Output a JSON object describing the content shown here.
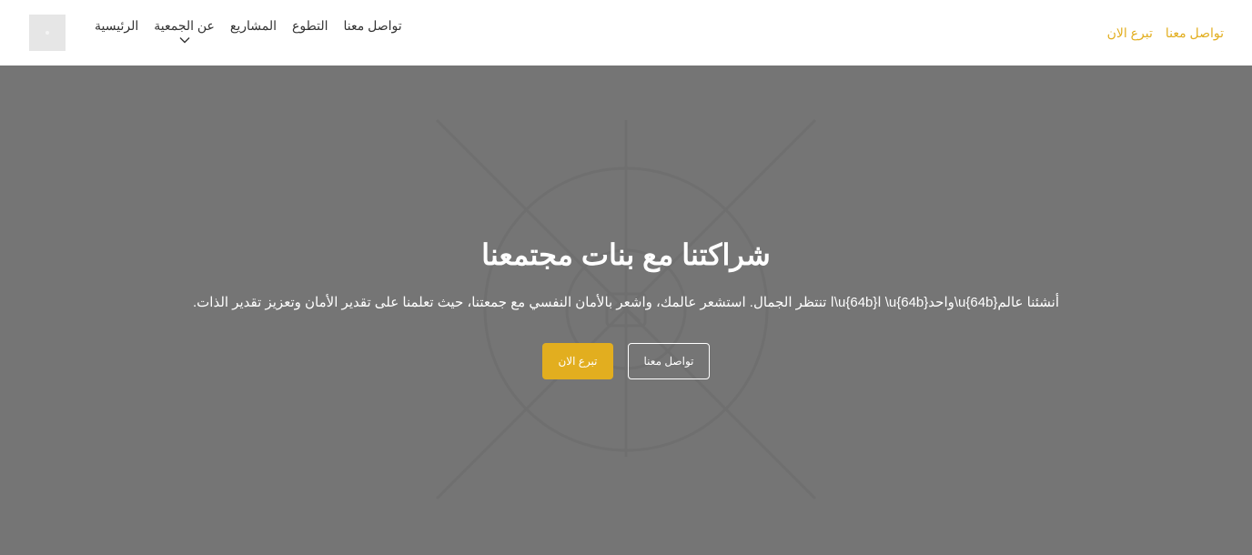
{
  "header": {
    "nav": [
      {
        "label": "الرئيسية"
      },
      {
        "label": "عن الجمعية"
      },
      {
        "label": "المشاريع"
      },
      {
        "label": "التطوع"
      },
      {
        "label": "تواصل معنا"
      }
    ],
    "links": {
      "donate": "تبرع الان",
      "contact": "تواصل معنا"
    }
  },
  "hero": {
    "title": "شراكتنا مع بنات مجتمعنا",
    "text": ".ا تنتظر الجمال. استشعر عالمك، واشعر بالأمان النفسي مع جمعتنا، حيث تعلمنا على تقدير الأمان وتعزيز تقدير الذات\\u{64b}ا \\u{64b}واحد\\u{64b}أنشئنا عالم",
    "donate_button": "تبرع الان",
    "contact_button": "تواصل معنا"
  },
  "colors": {
    "accent": "#e2ae1f",
    "hero_background": "#757575"
  },
  "icons": {
    "dropdown": "chevron-down-icon",
    "hero_placeholder": "image-placeholder-icon"
  }
}
